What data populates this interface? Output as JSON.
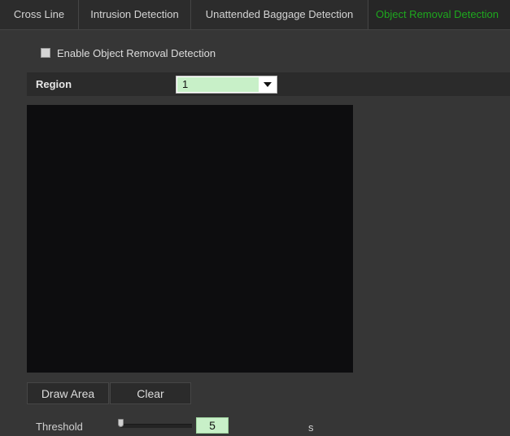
{
  "tabs": [
    {
      "label": "Cross Line"
    },
    {
      "label": "Intrusion Detection"
    },
    {
      "label": "Unattended Baggage Detection"
    },
    {
      "label": "Object Removal Detection",
      "active": true
    }
  ],
  "enable": {
    "label": "Enable Object Removal Detection",
    "checked": false
  },
  "region": {
    "label": "Region",
    "value": "1"
  },
  "buttons": {
    "draw_area": "Draw Area",
    "clear": "Clear"
  },
  "threshold": {
    "label": "Threshold",
    "value": "5",
    "unit": "s"
  },
  "colors": {
    "active_tab": "#1ea81e",
    "input_bg": "#c8f0c8",
    "background": "#363636",
    "video_bg": "#0d0d0f"
  }
}
